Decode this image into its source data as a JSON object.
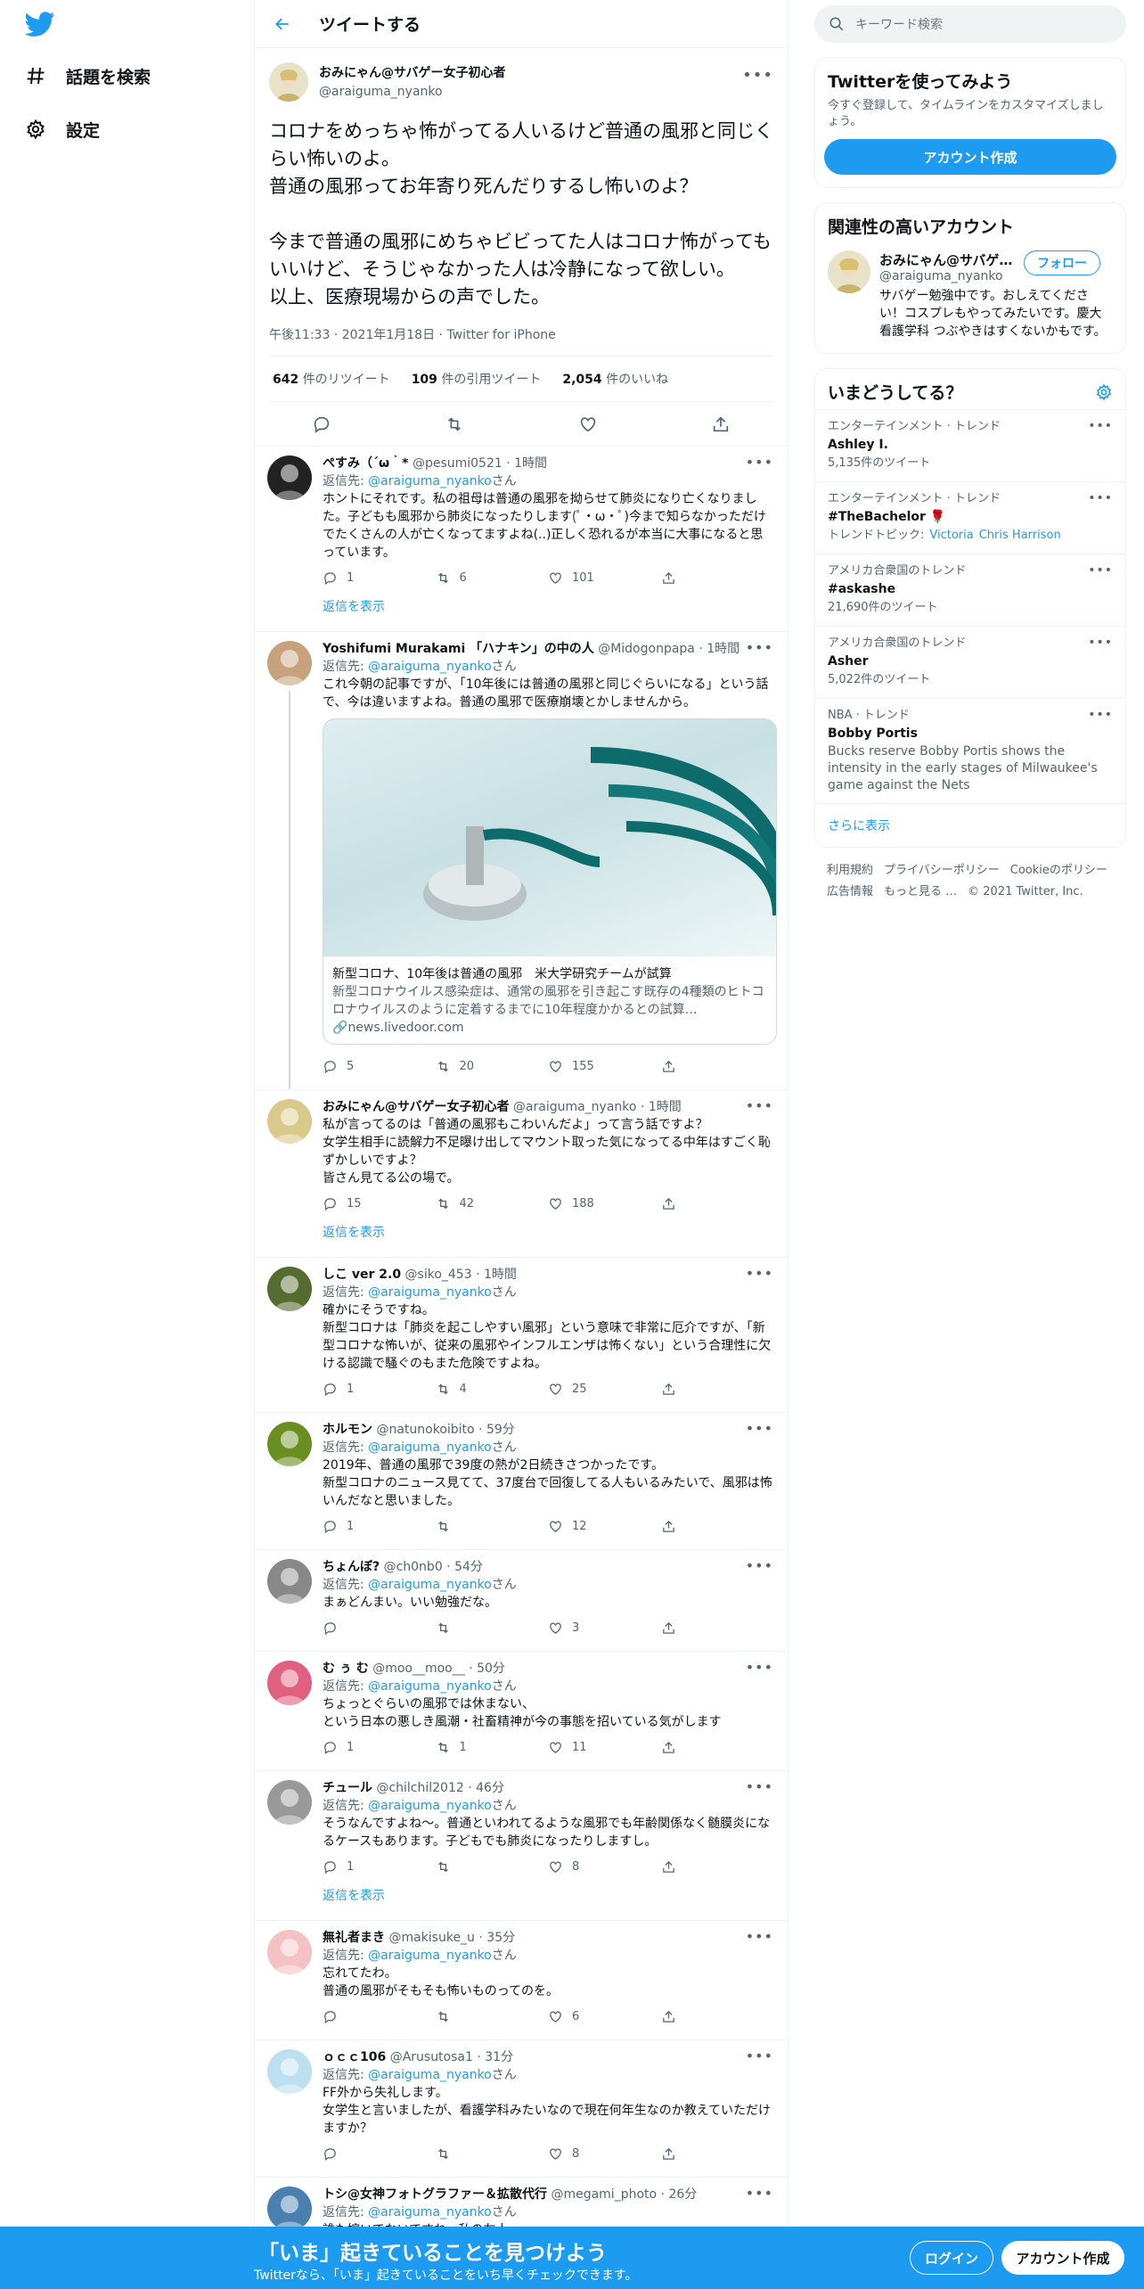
{
  "nav": {
    "explore_label": "話題を検索",
    "settings_label": "設定"
  },
  "header": {
    "title": "ツイートする"
  },
  "focal": {
    "name": "おみにゃん@サバゲー女子初心者",
    "handle": "@araiguma_nyanko",
    "text": "コロナをめっちゃ怖がってる人いるけど普通の風邪と同じくらい怖いのよ。\n普通の風邪ってお年寄り死んだりするし怖いのよ？\n\n今まで普通の風邪にめちゃビビってた人はコロナ怖がってもいいけど、そうじゃなかった人は冷静になって欲しい。\n以上、医療現場からの声でした。",
    "time": "午後11:33",
    "date": "2021年1月18日",
    "source": "Twitter for iPhone",
    "retweets": "642",
    "retweets_label": "件のリツイート",
    "quotes": "109",
    "quotes_label": "件の引用ツイート",
    "likes": "2,054",
    "likes_label": "件のいいね"
  },
  "reply_to_label": "返信先:",
  "reply_to_suffix": "さん",
  "show_replies_label": "返信を表示",
  "replies": [
    {
      "name": "ぺすみ（´ω｀*",
      "handle": "@pesumi0521",
      "time": "1時間",
      "to": "@araiguma_nyanko",
      "text": "ホントにそれです。私の祖母は普通の風邪を拗らせて肺炎になり亡くなりました。子どもも風邪から肺炎になったりします(ﾟ・ω・ﾟ)今まで知らなかっただけでたくさんの人が亡くなってますよね(..)正しく恐れるが本当に大事になると思っています。",
      "reply": "1",
      "rt": "6",
      "like": "101",
      "show_replies": true,
      "color": "#222"
    },
    {
      "name": "Yoshifumi Murakami 「ハナキン」の中の人",
      "handle": "@Midogonpapa",
      "time": "1時間",
      "to": "@araiguma_nyanko",
      "text": "これ今朝の記事ですが、「10年後には普通の風邪と同じぐらいになる」という話で、今は違いますよね。普通の風邪で医療崩壊とかしませんから。",
      "reply": "5",
      "rt": "20",
      "like": "155",
      "thread": true,
      "color": "#c8a27c",
      "card": {
        "title": "新型コロナ、10年後は普通の風邪　米大学研究チームが試算",
        "desc": "新型コロナウイルス感染症は、通常の風邪を引き起こす既存の4種類のヒトコロナウイルスのように定着するまでに10年程度かかるとの試算…",
        "domain": "news.livedoor.com"
      }
    },
    {
      "name": "おみにゃん@サバゲー女子初心者",
      "handle": "@araiguma_nyanko",
      "time": "1時間",
      "text": "私が言ってるのは「普通の風邪もこわいんだよ」って言う話ですよ？\n女学生相手に読解力不足曝け出してマウント取った気になってる中年はすごく恥ずかしいですよ？\n皆さん見てる公の場で。",
      "reply": "15",
      "rt": "42",
      "like": "188",
      "show_replies": true,
      "color": "#d9c98a"
    },
    {
      "name": "しこ ver 2.0",
      "handle": "@siko_453",
      "time": "1時間",
      "to": "@araiguma_nyanko",
      "text": "確かにそうですね。\n新型コロナは「肺炎を起こしやすい風邪」という意味で非常に厄介ですが、「新型コロナな怖いが、従来の風邪やインフルエンザは怖くない」という合理性に欠ける認識で騒ぐのもまた危険ですよね。",
      "reply": "1",
      "rt": "4",
      "like": "25",
      "color": "#556b2f"
    },
    {
      "name": "ホルモン",
      "handle": "@natunokoibito",
      "time": "59分",
      "to": "@araiguma_nyanko",
      "text": "2019年、普通の風邪で39度の熱が2日続きさつかったです。\n新型コロナのニュース見てて、37度台で回復してる人もいるみたいで、風邪は怖いんだなと思いました。",
      "reply": "1",
      "rt": "",
      "like": "12",
      "color": "#6b8e23"
    },
    {
      "name": "ちょんぼ?",
      "handle": "@ch0nb0",
      "time": "54分",
      "to": "@araiguma_nyanko",
      "text": "まぁどんまい。いい勉強だな。",
      "reply": "",
      "rt": "",
      "like": "3",
      "color": "#888"
    },
    {
      "name": "む ぅ む",
      "handle": "@moo__moo__",
      "time": "50分",
      "to": "@araiguma_nyanko",
      "text": "ちょっとぐらいの風邪では休まない、\nという日本の悪しき風潮・社畜精神が今の事態を招いている気がします",
      "reply": "1",
      "rt": "1",
      "like": "11",
      "color": "#e06080"
    },
    {
      "name": "チュール",
      "handle": "@chilchil2012",
      "time": "46分",
      "to": "@araiguma_nyanko",
      "text": "そうなんですよね〜。普通といわれてるような風邪でも年齢関係なく髄膜炎になるケースもあります。子どもでも肺炎になったりしますし。",
      "reply": "1",
      "rt": "",
      "like": "8",
      "show_replies": true,
      "color": "#999"
    },
    {
      "name": "無礼者まき",
      "handle": "@makisuke_u",
      "time": "35分",
      "to": "@araiguma_nyanko",
      "text": "忘れてたわ。\n普通の風邪がそもそも怖いものってのを。",
      "reply": "",
      "rt": "",
      "like": "6",
      "color": "#f4c2c2"
    },
    {
      "name": "ｏｃｃ106",
      "handle": "@Arusutosa1",
      "time": "31分",
      "to": "@araiguma_nyanko",
      "text": "FF外から失礼します。\n女学生と言いましたが、看護学科みたいなので現在何年生なのか教えていただけますか？",
      "reply": "",
      "rt": "",
      "like": "8",
      "color": "#bde0f0"
    },
    {
      "name": "トシ@女神フォトグラファー＆拡散代行",
      "handle": "@megami_photo",
      "time": "26分",
      "to": "@araiguma_nyanko",
      "text": "誰も嫁いでないですね...私の友人...",
      "reply": "",
      "rt": "",
      "like": "",
      "color": "#4a7fb0"
    }
  ],
  "search": {
    "placeholder": "キーワード検索"
  },
  "join": {
    "title": "Twitterを使ってみよう",
    "desc": "今すぐ登録して、タイムラインをカスタマイズしましょう。",
    "button": "アカウント作成"
  },
  "relevant": {
    "title": "関連性の高いアカウント",
    "name": "おみにゃん@サバゲー女子初心者",
    "handle": "@araiguma_nyanko",
    "follow": "フォロー",
    "bio": "サバゲー勉強中です。おしえてください！コスプレもやってみたいです。慶大看護学科 つぶやきはすくないかもです。"
  },
  "trends": {
    "title": "いまどうしてる？",
    "items": [
      {
        "ctx": "エンターテインメント · トレンド",
        "title": "Ashley I.",
        "count": "5,135件のツイート"
      },
      {
        "ctx": "エンターテインメント · トレンド",
        "title": "#TheBachelor 🌹",
        "topics_label": "トレンドトピック:",
        "topics": [
          "Victoria",
          "Chris Harrison"
        ]
      },
      {
        "ctx": "アメリカ合衆国のトレンド",
        "title": "#askashe",
        "count": "21,690件のツイート"
      },
      {
        "ctx": "アメリカ合衆国のトレンド",
        "title": "Asher",
        "count": "5,022件のツイート"
      },
      {
        "ctx": "NBA · トレンド",
        "title": "Bobby Portis",
        "desc": "Bucks reserve Bobby Portis shows the intensity in the early stages of Milwaukee's game against the Nets"
      }
    ],
    "show_more": "さらに表示"
  },
  "footer": [
    "利用規約",
    "プライバシーポリシー",
    "Cookieのポリシー",
    "広告情報",
    "もっと見る …",
    "© 2021 Twitter, Inc."
  ],
  "banner": {
    "title": "「いま」起きていることを見つけよう",
    "subtitle": "Twitterなら、「いま」起きていることをいち早くチェックできます。",
    "login": "ログイン",
    "signup": "アカウント作成"
  },
  "colors": {
    "accent": "#1d9bf0",
    "text": "#0f1419",
    "muted": "#536471"
  }
}
